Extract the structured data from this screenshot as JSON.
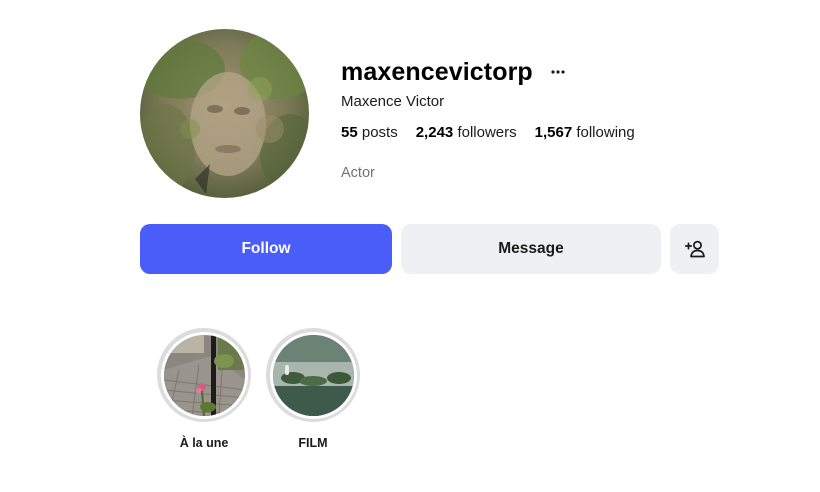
{
  "profile": {
    "username": "maxencevictorp",
    "full_name": "Maxence Victor",
    "category": "Actor",
    "more_icon": "ellipsis-icon",
    "avatar_icon": "profile-photo"
  },
  "stats": {
    "posts": {
      "count": "55",
      "label": "posts"
    },
    "followers": {
      "count": "2,243",
      "label": "followers"
    },
    "following": {
      "count": "1,567",
      "label": "following"
    }
  },
  "actions": {
    "follow_label": "Follow",
    "message_label": "Message",
    "suggest_icon": "add-person-icon"
  },
  "highlights": [
    {
      "label": "À la une",
      "thumbnail": "garden-path-photo"
    },
    {
      "label": "FILM",
      "thumbnail": "film-landscape-photo"
    }
  ],
  "colors": {
    "follow_button": "#4a5df9",
    "secondary_button": "#eff0f3",
    "muted_text": "#737373",
    "highlight_ring": "#dcdcdc"
  }
}
